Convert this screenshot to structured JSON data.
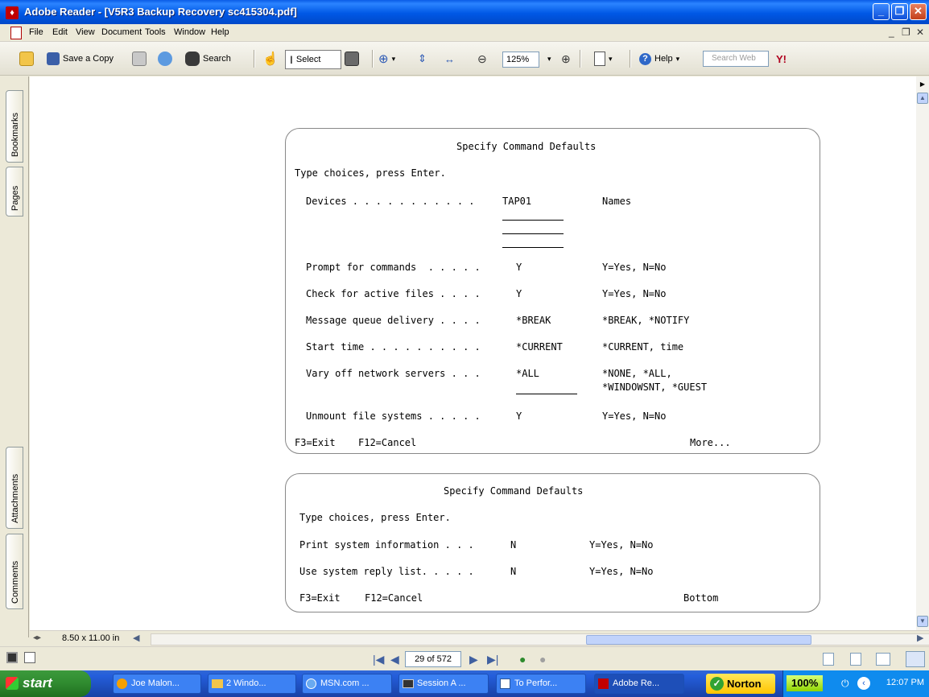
{
  "window": {
    "title": "Adobe Reader - [V5R3 Backup Recovery sc415304.pdf]",
    "min_glyph": "_",
    "max_glyph": "❐",
    "close_glyph": "✕"
  },
  "menu": {
    "items": [
      "File",
      "Edit",
      "View",
      "Document",
      "Tools",
      "Window",
      "Help"
    ],
    "mdi_min": "_",
    "mdi_restore": "❐",
    "mdi_close": "✕"
  },
  "toolbar": {
    "save_copy": "Save a Copy",
    "search": "Search",
    "select": "Select",
    "zoom": "125%",
    "help": "Help",
    "search_web_placeholder": "Search Web",
    "yahoo": "Y!"
  },
  "nav_tabs": [
    "Bookmarks",
    "Pages",
    "Attachments",
    "Comments"
  ],
  "page_size": "8.50 x 11.00 in",
  "page_indicator": "29 of 572",
  "panel1": {
    "title": "Specify Command Defaults",
    "instruction": "Type choices, press Enter.",
    "rows": [
      {
        "label": "Devices . . . . . . . . . . .",
        "value": "TAP01",
        "options": "Names"
      },
      {
        "label": "Prompt for commands  . . . . .",
        "value": "Y",
        "options": "Y=Yes, N=No"
      },
      {
        "label": "Check for active files . . . .",
        "value": "Y",
        "options": "Y=Yes, N=No"
      },
      {
        "label": "Message queue delivery . . . .",
        "value": "*BREAK",
        "options": "*BREAK, *NOTIFY"
      },
      {
        "label": "Start time . . . . . . . . . .",
        "value": "*CURRENT",
        "options": "*CURRENT, time"
      },
      {
        "label": "Vary off network servers . . .",
        "value": "*ALL",
        "options": "*NONE, *ALL,",
        "options2": "*WINDOWSNT, *GUEST"
      },
      {
        "label": "Unmount file systems . . . . .",
        "value": "Y",
        "options": "Y=Yes, N=No"
      }
    ],
    "f3": "F3=Exit",
    "f12": "F12=Cancel",
    "more": "More..."
  },
  "panel2": {
    "title": "Specify Command Defaults",
    "instruction": "Type choices, press Enter.",
    "rows": [
      {
        "label": "Print system information . . .",
        "value": "N",
        "options": "Y=Yes, N=No"
      },
      {
        "label": "Use system reply list. . . . .",
        "value": "N",
        "options": "Y=Yes, N=No"
      }
    ],
    "f3": "F3=Exit",
    "f12": "F12=Cancel",
    "more": "Bottom"
  },
  "taskbar": {
    "start": "start",
    "tasks": [
      "Joe Malon...",
      "2 Windo...",
      "MSN.com ...",
      "Session A ...",
      "To Perfor...",
      "Adobe Re..."
    ],
    "norton": "Norton",
    "zoom_badge": "100%",
    "clock": "12:07 PM"
  },
  "colors": {
    "titlebar": "#0058e6",
    "taskbar": "#245edb",
    "start": "#2f8a2f",
    "chrome": "#ece9d8"
  }
}
